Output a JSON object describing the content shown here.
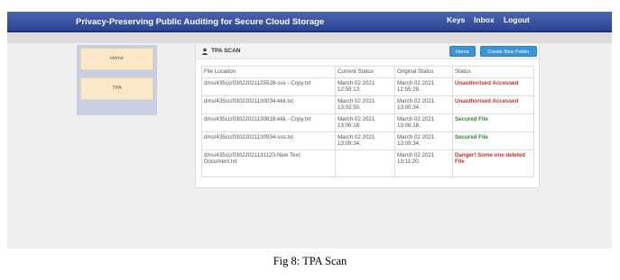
{
  "navbar": {
    "title": "Privacy-Preserving Public Auditing for Secure Cloud Storage",
    "links": [
      "Keys",
      "Inbox",
      "Logout"
    ]
  },
  "sidebar": {
    "items": [
      "Home",
      "TPA"
    ]
  },
  "panel": {
    "title": "TPA SCAN",
    "icon": "user-icon",
    "buttons": {
      "home": "Home",
      "create_folder": "Create New Folder"
    }
  },
  "table": {
    "headers": [
      "File Location",
      "Current Status",
      "Original Status",
      "Status"
    ],
    "rows": [
      {
        "file": "dms/435cc/03022021125528-sss - Copy.txt",
        "current": "March 02 2021 12:59:13.",
        "original": "March 02 2021 12:55:28.",
        "status": "Unauthorised Accessed"
      },
      {
        "file": "dms/435cc/03022021130034-kkk.txt",
        "current": "March 02 2021 13:02:50.",
        "original": "March 02 2021 13:00:34.",
        "status": "Unauthorised Accessed"
      },
      {
        "file": "dms/435cc/03022021130618-kkk - Copy.txt",
        "current": "March 02 2021 13:06:18.",
        "original": "March 02 2021 13:06:18.",
        "status": "Secured File"
      },
      {
        "file": "dms/435cc/03022021130934-sss.txt",
        "current": "March 02 2021 13:09:34.",
        "original": "March 02 2021 13:09:34.",
        "status": "Secured File"
      },
      {
        "file": "dms/435cc/03022021131120-New Text Document.txt",
        "current": "",
        "original": "March 02 2021 13:11:20.",
        "status": "Danger! Some one deleted File"
      }
    ]
  },
  "colors": {
    "nav": "#3a55a4",
    "danger": "#c9302c",
    "secured": "#2e8b2e",
    "button": "#3a95d6",
    "sidebar_item": "#fae8c9"
  },
  "caption": "Fig 8: TPA Scan"
}
